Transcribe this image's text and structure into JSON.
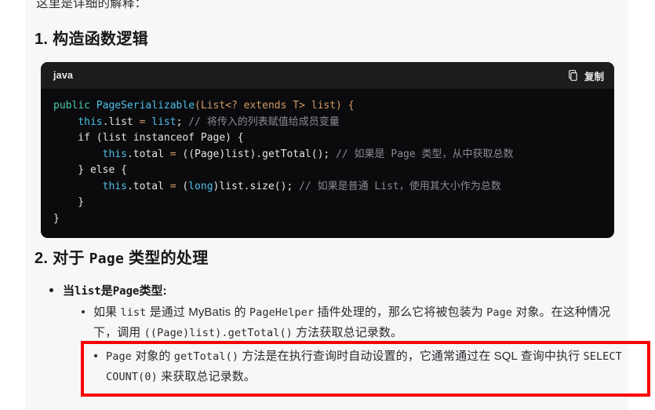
{
  "document": {
    "intro_paragraph": "这里是详细的解释：",
    "sections": [
      {
        "heading_number": "1.",
        "heading_text": "构造函数逻辑"
      },
      {
        "heading_number": "2.",
        "heading_prefix": "对于",
        "heading_mono": "Page",
        "heading_suffix": "类型的处理"
      }
    ]
  },
  "code_block": {
    "language_label": "java",
    "copy_button_label": "复制",
    "copy_icon": "copy-icon",
    "lines": [
      {
        "tokens": [
          {
            "t": "public",
            "c": "t-kw"
          },
          {
            "t": " ",
            "c": "t-plain"
          },
          {
            "t": "PageSerializable",
            "c": "t-type"
          },
          {
            "t": "(",
            "c": "t-punct"
          },
          {
            "t": "List<? extends T> list",
            "c": "t-punct"
          },
          {
            "t": ")",
            "c": "t-punct"
          },
          {
            "t": " ",
            "c": "t-plain"
          },
          {
            "t": "{",
            "c": "t-punct"
          }
        ]
      },
      {
        "tokens": [
          {
            "t": "    ",
            "c": "t-plain"
          },
          {
            "t": "this",
            "c": "t-this"
          },
          {
            "t": ".list",
            "c": "t-plain"
          },
          {
            "t": " = ",
            "c": "t-op"
          },
          {
            "t": "list",
            "c": "t-this"
          },
          {
            "t": "; ",
            "c": "t-plain"
          },
          {
            "t": "// 将传入的列表赋值给成员变量",
            "c": "t-cmt"
          }
        ]
      },
      {
        "tokens": [
          {
            "t": "    if (list instanceof Page) {",
            "c": "t-plain"
          }
        ]
      },
      {
        "tokens": [
          {
            "t": "        ",
            "c": "t-plain"
          },
          {
            "t": "this",
            "c": "t-this"
          },
          {
            "t": ".total",
            "c": "t-plain"
          },
          {
            "t": " = ",
            "c": "t-op"
          },
          {
            "t": "((Page)list).getTotal(); ",
            "c": "t-plain"
          },
          {
            "t": "// 如果是 Page 类型，从中获取总数",
            "c": "t-cmt"
          }
        ]
      },
      {
        "tokens": [
          {
            "t": "    } else {",
            "c": "t-plain"
          }
        ]
      },
      {
        "tokens": [
          {
            "t": "        ",
            "c": "t-plain"
          },
          {
            "t": "this",
            "c": "t-this"
          },
          {
            "t": ".total",
            "c": "t-plain"
          },
          {
            "t": " = ",
            "c": "t-op"
          },
          {
            "t": "(",
            "c": "t-plain"
          },
          {
            "t": "long",
            "c": "t-this"
          },
          {
            "t": ")list.size(); ",
            "c": "t-plain"
          },
          {
            "t": "// 如果是普通 List，使用其大小作为总数",
            "c": "t-cmt"
          }
        ]
      },
      {
        "tokens": [
          {
            "t": "    }",
            "c": "t-plain"
          }
        ]
      },
      {
        "tokens": [
          {
            "t": "}",
            "c": "t-plain"
          }
        ]
      }
    ]
  },
  "bullets": {
    "level1": {
      "prefix": "当",
      "mono1": "list",
      "middle": "是",
      "mono2": "Page",
      "suffix": "类型:"
    },
    "level2_first": {
      "part1": "如果 ",
      "mono1": "list",
      "part2": " 是通过 MyBatis 的 ",
      "mono2": "PageHelper",
      "part3": " 插件处理的，那么它将被包装为 ",
      "mono3": "Page",
      "part4": " 对象。在这种情况下，调用 ",
      "mono4": "((Page)list).getTotal()",
      "part5": " 方法获取总记录数。"
    },
    "level2_highlighted": {
      "mono1": "Page",
      "part1": " 对象的 ",
      "mono2": "getTotal()",
      "part2": " 方法是在执行查询时自动设置的，它通常通过在 SQL 查询中执行 ",
      "mono3": "SELECT COUNT(0)",
      "part3": " 来获取总记录数。"
    }
  },
  "colors": {
    "page_background": "#ffffff",
    "content_background": "#f7f7f8",
    "code_background": "#0b0b0d",
    "code_header_background": "#1c1c1f",
    "highlight_border": "#fa0000",
    "text_primary": "#17171a",
    "comment": "#8a8a93",
    "keyword": "#4ec9b0",
    "type": "#4fc1e9",
    "punctuation": "#d19a66"
  }
}
